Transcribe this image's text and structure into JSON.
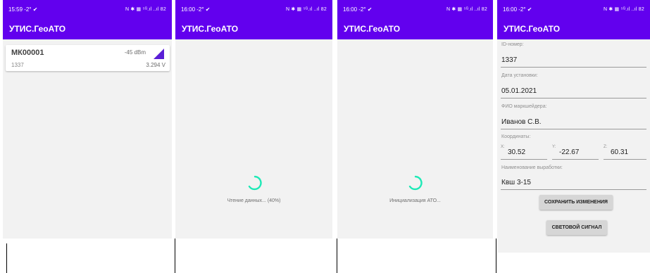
{
  "screens": [
    {
      "status": {
        "time": "15:59",
        "extra": "-2° ✔",
        "right": "N ✱ ▦ ⁵ᴳ.ıl ..ıl 82"
      },
      "app_title": "УТИС.ГеоАТО",
      "device": {
        "id": "МК00001",
        "signal": "-45 dBm",
        "number": "1337",
        "voltage": "3.294 V",
        "signal_icon": "signal-strength-icon"
      }
    },
    {
      "status": {
        "time": "16:00",
        "extra": "-2° ✔",
        "right": "N ✱ ▦ ⁵ᴳ.ıl ..ıl 82"
      },
      "app_title": "УТИС.ГеоАТО",
      "loading_text": "Чтение данных... (40%)"
    },
    {
      "status": {
        "time": "16:00",
        "extra": "-2° ✔",
        "right": "N ✱ ▦ ⁵ᴳ.ıl ..ıl 82"
      },
      "app_title": "УТИС.ГеоАТО",
      "loading_text": "Инициализация АТО..."
    },
    {
      "status": {
        "time": "16:00",
        "extra": "-2° ✔",
        "right": "N ✱ ▦ ⁵ᴳ.ıl ..ıl 82"
      },
      "app_title": "УТИС.ГеоАТО",
      "form": {
        "id_label": "ID-номер:",
        "id_value": "1337",
        "date_label": "Дата установки:",
        "date_value": "05.01.2021",
        "name_label": "ФИО маркшейдера:",
        "name_value": "Иванов С.В.",
        "coords_label": "Координаты:",
        "x_prefix": "X:",
        "x_value": "30.52",
        "y_prefix": "Y:",
        "y_value": "-22.67",
        "z_prefix": "Z:",
        "z_value": "60.31",
        "working_label": "Наименование выработки:",
        "working_value": "Квш 3-15",
        "save_button": "СОХРАНИТЬ ИЗМЕНЕНИЯ",
        "signal_button": "СВЕТОВОЙ СИГНАЛ"
      }
    }
  ],
  "colors": {
    "primary": "#6200ee",
    "spinner": "#1de9b6",
    "background": "#f2f2f2"
  }
}
